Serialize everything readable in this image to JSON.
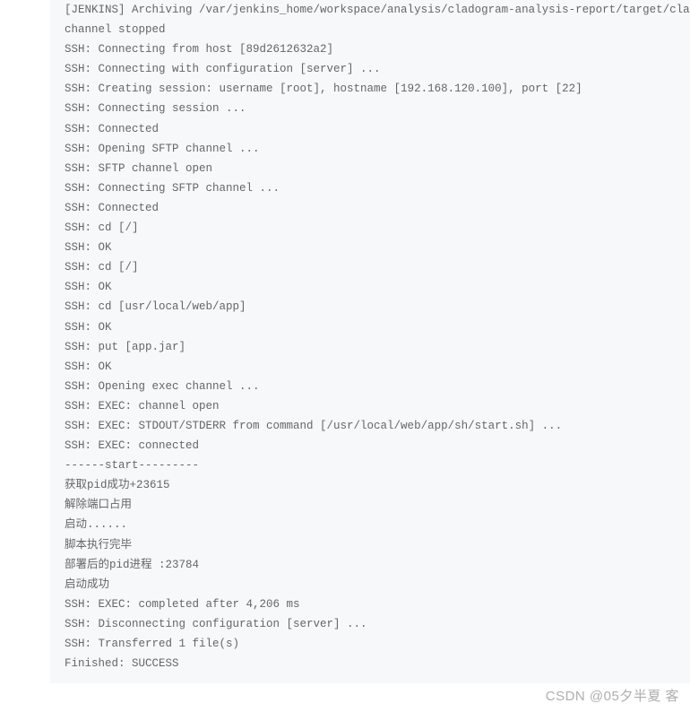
{
  "console": {
    "lines": [
      "[JENKINS] Archiving /var/jenkins_home/workspace/analysis/cladogram-analysis-report/target/cladogra",
      "channel stopped",
      "SSH: Connecting from host [89d2612632a2]",
      "SSH: Connecting with configuration [server] ...",
      "SSH: Creating session: username [root], hostname [192.168.120.100], port [22]",
      "SSH: Connecting session ...",
      "SSH: Connected",
      "SSH: Opening SFTP channel ...",
      "SSH: SFTP channel open",
      "SSH: Connecting SFTP channel ...",
      "SSH: Connected",
      "SSH: cd [/]",
      "SSH: OK",
      "SSH: cd [/]",
      "SSH: OK",
      "SSH: cd [usr/local/web/app]",
      "SSH: OK",
      "SSH: put [app.jar]",
      "SSH: OK",
      "SSH: Opening exec channel ...",
      "SSH: EXEC: channel open",
      "SSH: EXEC: STDOUT/STDERR from command [/usr/local/web/app/sh/start.sh] ...",
      "SSH: EXEC: connected",
      "------start---------",
      "获取pid成功+23615",
      "解除端口占用",
      "启动......",
      "脚本执行完毕",
      "部署后的pid进程 :23784",
      "启动成功",
      "SSH: EXEC: completed after 4,206 ms",
      "SSH: Disconnecting configuration [server] ...",
      "SSH: Transferred 1 file(s)",
      "Finished: SUCCESS"
    ]
  },
  "watermark": {
    "text": "CSDN @05夕半夏 客"
  }
}
